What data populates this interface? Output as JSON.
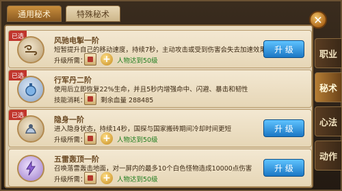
{
  "tabs": [
    {
      "label": "通用秘术",
      "active": true
    },
    {
      "label": "特殊秘术",
      "active": false
    }
  ],
  "close_symbol": "✕",
  "side_menu": [
    {
      "label": "职业",
      "active": false
    },
    {
      "label": "秘术",
      "active": true
    },
    {
      "label": "心法",
      "active": false
    },
    {
      "label": "动作",
      "active": false
    }
  ],
  "skills": [
    {
      "badge": "已选",
      "name": "风驰电掣一阶",
      "desc": "短暂提升自己的移动速度，持续7秒，主动攻击或受到伤害会失去加速效果",
      "req_label": "升级所需：",
      "req_text": "人物达到50级",
      "button": "升 级",
      "icon": "wind-icon"
    },
    {
      "badge": "已选",
      "name": "行军丹二阶",
      "desc": "使用后立即恢复22%生命，并且5秒内增强命中、闪避、暴击和韧性",
      "req_label": "技能消耗：",
      "req_text": "剩余血量 288485",
      "button": "",
      "icon": "potion-icon"
    },
    {
      "badge": "已选",
      "name": "隐身一阶",
      "desc": "进入隐身状态，持续14秒，国探与国家搬砖期间冷却时间更短",
      "req_label": "升级所需：",
      "req_text": "人物达到50级",
      "button": "升 级",
      "icon": "stealth-icon"
    },
    {
      "badge": "",
      "name": "五雷轰顶一阶",
      "desc": "召唤落雷轰击地面，对一屏内的最多10个白色怪物造成10000点伤害",
      "req_label": "升级所需：",
      "req_text": "人物达到50级",
      "button": "升 级",
      "icon": "thunder-icon"
    }
  ]
}
